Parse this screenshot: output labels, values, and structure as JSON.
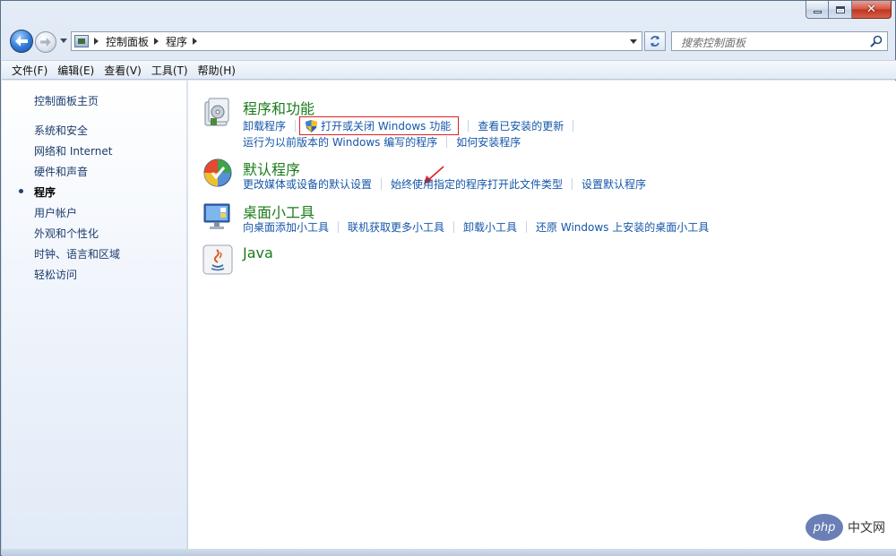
{
  "nav": {
    "breadcrumb": [
      "控制面板",
      "程序"
    ],
    "search_placeholder": "搜索控制面板"
  },
  "menu": [
    "文件(F)",
    "编辑(E)",
    "查看(V)",
    "工具(T)",
    "帮助(H)"
  ],
  "sidebar": {
    "items": [
      {
        "label": "控制面板主页"
      },
      {
        "label": "系统和安全"
      },
      {
        "label": "网络和 Internet"
      },
      {
        "label": "硬件和声音"
      },
      {
        "label": "程序",
        "current": true
      },
      {
        "label": "用户帐户"
      },
      {
        "label": "外观和个性化"
      },
      {
        "label": "时钟、语言和区域"
      },
      {
        "label": "轻松访问"
      }
    ]
  },
  "categories": [
    {
      "title": "程序和功能",
      "icon": "programs-features-icon",
      "rows": [
        [
          "卸载程序",
          "打开或关闭 Windows 功能",
          "查看已安装的更新"
        ],
        [
          "运行为以前版本的 Windows 编写的程序",
          "如何安装程序"
        ]
      ]
    },
    {
      "title": "默认程序",
      "icon": "default-programs-icon",
      "rows": [
        [
          "更改媒体或设备的默认设置",
          "始终使用指定的程序打开此文件类型",
          "设置默认程序"
        ]
      ]
    },
    {
      "title": "桌面小工具",
      "icon": "desktop-gadgets-icon",
      "rows": [
        [
          "向桌面添加小工具",
          "联机获取更多小工具",
          "卸载小工具",
          "还原 Windows 上安装的桌面小工具"
        ]
      ]
    },
    {
      "title": "Java",
      "icon": "java-icon",
      "rows": []
    }
  ],
  "watermark": {
    "logo": "php",
    "text": "中文网"
  },
  "colors": {
    "link": "#1556a8",
    "category_title": "#1a7a1a",
    "highlight_box": "#e02020"
  }
}
